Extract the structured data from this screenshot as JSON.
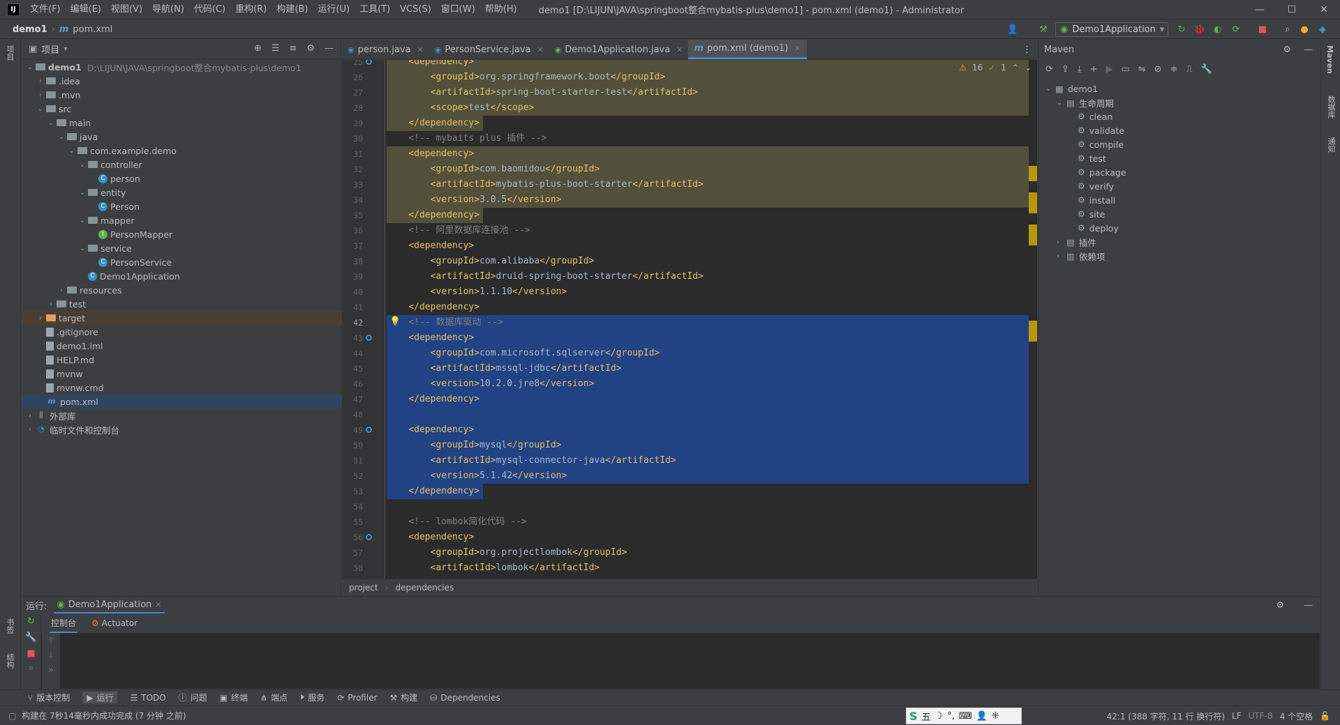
{
  "window": {
    "title": "demo1 [D:\\LIJUN\\JAVA\\springboot整合mybatis-plus\\demo1] - pom.xml (demo1) - Administrator",
    "menus": [
      "文件(F)",
      "编辑(E)",
      "视图(V)",
      "导航(N)",
      "代码(C)",
      "重构(R)",
      "构建(B)",
      "运行(U)",
      "工具(T)",
      "VCS(S)",
      "窗口(W)",
      "帮助(H)"
    ],
    "controls": {
      "minimize": "—",
      "maximize": "☐",
      "close": "✕"
    }
  },
  "navbar": {
    "project": "demo1",
    "file": "pom.xml",
    "run_config": "Demo1Application"
  },
  "left_strip": {
    "project_tab": "项目",
    "bookmarks_tab": "书签",
    "structure_tab": "结构"
  },
  "right_strip": {
    "maven_tab": "Maven",
    "db_tab": "数据库",
    "notifications_tab": "通知"
  },
  "project_panel": {
    "title": "项目",
    "tree": [
      {
        "label": "demo1",
        "path": "D:\\LIJUN\\JAVA\\springboot整合mybatis-plus\\demo1",
        "icon": "module-folder-icon",
        "arrow": "⌄",
        "depth": 0
      },
      {
        "label": ".idea",
        "icon": "folder-icon",
        "arrow": "›",
        "depth": 1
      },
      {
        "label": ".mvn",
        "icon": "folder-icon",
        "arrow": "›",
        "depth": 1
      },
      {
        "label": "src",
        "icon": "folder-icon",
        "arrow": "⌄",
        "depth": 1
      },
      {
        "label": "main",
        "icon": "folder-icon",
        "arrow": "⌄",
        "depth": 2
      },
      {
        "label": "java",
        "icon": "source-folder-icon",
        "arrow": "⌄",
        "depth": 3
      },
      {
        "label": "com.example.demo",
        "icon": "package-icon",
        "arrow": "⌄",
        "depth": 4
      },
      {
        "label": "controller",
        "icon": "package-icon",
        "arrow": "⌄",
        "depth": 5
      },
      {
        "label": "person",
        "icon": "class-icon",
        "arrow": "",
        "depth": 6
      },
      {
        "label": "entity",
        "icon": "package-icon",
        "arrow": "⌄",
        "depth": 5
      },
      {
        "label": "Person",
        "icon": "class-icon",
        "arrow": "",
        "depth": 6
      },
      {
        "label": "mapper",
        "icon": "package-icon",
        "arrow": "⌄",
        "depth": 5
      },
      {
        "label": "PersonMapper",
        "icon": "interface-icon",
        "arrow": "",
        "depth": 6
      },
      {
        "label": "service",
        "icon": "package-icon",
        "arrow": "⌄",
        "depth": 5
      },
      {
        "label": "PersonService",
        "icon": "class-icon",
        "arrow": "",
        "depth": 6
      },
      {
        "label": "Demo1Application",
        "icon": "spring-class-icon",
        "arrow": "",
        "depth": 5
      },
      {
        "label": "resources",
        "icon": "resources-folder-icon",
        "arrow": "›",
        "depth": 3
      },
      {
        "label": "test",
        "icon": "folder-icon",
        "arrow": "›",
        "depth": 2
      },
      {
        "label": "target",
        "icon": "excluded-folder-icon",
        "arrow": "›",
        "depth": 1
      },
      {
        "label": ".gitignore",
        "icon": "file-icon",
        "arrow": "",
        "depth": 1
      },
      {
        "label": "demo1.iml",
        "icon": "file-icon",
        "arrow": "",
        "depth": 1
      },
      {
        "label": "HELP.md",
        "icon": "markdown-file-icon",
        "arrow": "",
        "depth": 1
      },
      {
        "label": "mvnw",
        "icon": "file-icon",
        "arrow": "",
        "depth": 1
      },
      {
        "label": "mvnw.cmd",
        "icon": "file-icon",
        "arrow": "",
        "depth": 1
      },
      {
        "label": "pom.xml",
        "icon": "maven-file-icon",
        "arrow": "",
        "depth": 1
      },
      {
        "label": "外部库",
        "icon": "library-icon",
        "arrow": "›",
        "depth": 0
      },
      {
        "label": "临时文件和控制台",
        "icon": "scratch-icon",
        "arrow": "›",
        "depth": 0
      }
    ]
  },
  "editor": {
    "tabs": [
      {
        "label": "person.java",
        "icon": "class-icon"
      },
      {
        "label": "PersonService.java",
        "icon": "class-icon"
      },
      {
        "label": "Demo1Application.java",
        "icon": "spring-class-icon"
      },
      {
        "label": "pom.xml (demo1)",
        "icon": "maven-file-icon"
      }
    ],
    "problems": {
      "warnings": "16",
      "ok": "1"
    },
    "breadcrumb": [
      "project",
      "dependencies"
    ],
    "lines": [
      {
        "n": "25",
        "text": "    <dependency>",
        "hl": "y",
        "mark": true
      },
      {
        "n": "26",
        "text": "        <groupId>org.springframework.boot</groupId>",
        "hl": "y"
      },
      {
        "n": "27",
        "text": "        <artifactId>spring-boot-starter-test</artifactId>",
        "hl": "y"
      },
      {
        "n": "28",
        "text": "        <scope>test</scope>",
        "hl": "y"
      },
      {
        "n": "29",
        "text": "    </dependency>",
        "hl": "y"
      },
      {
        "n": "30",
        "text": "    <!-- mybaits plus 插件 -->",
        "hl": "",
        "comment": true
      },
      {
        "n": "31",
        "text": "    <dependency>",
        "hl": "y"
      },
      {
        "n": "32",
        "text": "        <groupId>com.baomidou</groupId>",
        "hl": "y"
      },
      {
        "n": "33",
        "text": "        <artifactId>mybatis-plus-boot-starter</artifactId>",
        "hl": "y"
      },
      {
        "n": "34",
        "text": "        <version>3.0.5</version>",
        "hl": "y"
      },
      {
        "n": "35",
        "text": "    </dependency>",
        "hl": "y"
      },
      {
        "n": "36",
        "text": "    <!-- 阿里数据库连接池 -->",
        "hl": "",
        "comment": true
      },
      {
        "n": "37",
        "text": "    <dependency>",
        "hl": ""
      },
      {
        "n": "38",
        "text": "        <groupId>com.alibaba</groupId>",
        "hl": ""
      },
      {
        "n": "39",
        "text": "        <artifactId>druid-spring-boot-starter</artifactId>",
        "hl": ""
      },
      {
        "n": "40",
        "text": "        <version>1.1.10</version>",
        "hl": ""
      },
      {
        "n": "41",
        "text": "    </dependency>",
        "hl": ""
      },
      {
        "n": "42",
        "text": "    <!-- 数据库驱动 -->",
        "hl": "b",
        "comment": true
      },
      {
        "n": "43",
        "text": "    <dependency>",
        "hl": "b",
        "mark": true
      },
      {
        "n": "44",
        "text": "        <groupId>com.microsoft.sqlserver</groupId>",
        "hl": "b"
      },
      {
        "n": "45",
        "text": "        <artifactId>mssql-jdbc</artifactId>",
        "hl": "b"
      },
      {
        "n": "46",
        "text": "        <version>10.2.0.jre8</version>",
        "hl": "b"
      },
      {
        "n": "47",
        "text": "    </dependency>",
        "hl": "b"
      },
      {
        "n": "48",
        "text": "",
        "hl": "b"
      },
      {
        "n": "49",
        "text": "    <dependency>",
        "hl": "b",
        "mark": true
      },
      {
        "n": "50",
        "text": "        <groupId>mysql</groupId>",
        "hl": "b"
      },
      {
        "n": "51",
        "text": "        <artifactId>mysql-connector-java</artifactId>",
        "hl": "b"
      },
      {
        "n": "52",
        "text": "        <version>5.1.42</version>",
        "hl": "b"
      },
      {
        "n": "53",
        "text": "    </dependency>",
        "hl": "b"
      },
      {
        "n": "54",
        "text": "",
        "hl": ""
      },
      {
        "n": "55",
        "text": "    <!-- lombok简化代码 -->",
        "hl": "",
        "comment": true
      },
      {
        "n": "56",
        "text": "    <dependency>",
        "hl": "",
        "mark": true
      },
      {
        "n": "57",
        "text": "        <groupId>org.projectlombok</groupId>",
        "hl": ""
      },
      {
        "n": "58",
        "text": "        <artifactId>lombok</artifactId>",
        "hl": ""
      }
    ]
  },
  "maven": {
    "title": "Maven",
    "root": "demo1",
    "lifecycle_label": "生命周期",
    "lifecycle": [
      "clean",
      "validate",
      "compile",
      "test",
      "package",
      "verify",
      "install",
      "site",
      "deploy"
    ],
    "plugins_label": "插件",
    "deps_label": "依赖项"
  },
  "run": {
    "label": "运行:",
    "config": "Demo1Application",
    "tabs": [
      "控制台",
      "Actuator"
    ]
  },
  "bottom_tools": [
    "版本控制",
    "运行",
    "TODO",
    "问题",
    "终端",
    "端点",
    "服务",
    "Profiler",
    "构建",
    "Dependencies"
  ],
  "status": {
    "message": "构建在 7秒14毫秒内成功完成 (7 分钟 之前)",
    "ime": "五",
    "position": "42:1 (388 字符, 11 行 换行符)",
    "line_sep": "LF",
    "encoding": "UTF-8",
    "indent": "4 个空格"
  },
  "colors": {
    "accent": "#4a88c7",
    "tag": "#e8bf6a",
    "comment": "#808080",
    "selection": "#214283",
    "highlight": "#52503a"
  }
}
